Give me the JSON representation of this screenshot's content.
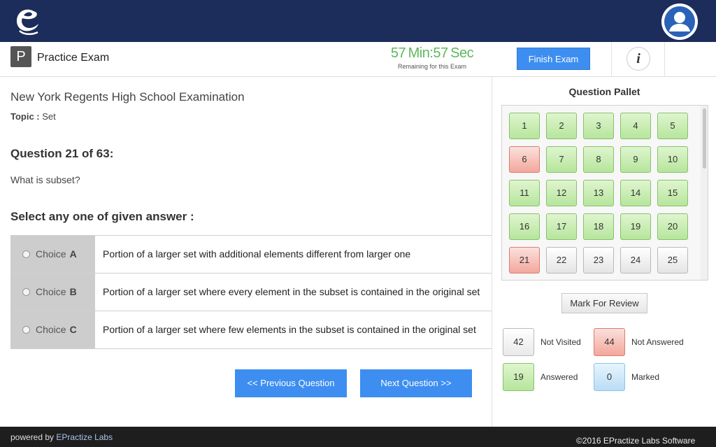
{
  "header": {
    "logo_icon": "epractize-e-logo-icon",
    "avatar_icon": "user-avatar-icon",
    "colors": {
      "topbar": "#1c2c5b",
      "accent": "#3d8ef0",
      "timer": "#5cb85c"
    }
  },
  "subheader": {
    "badge": "P",
    "title": "Practice Exam",
    "timer": {
      "minutes": "57",
      "min_label": "Min",
      "separator": ":",
      "seconds": "57",
      "sec_label": "Sec",
      "subtitle": "Remaining for this Exam"
    },
    "finish_label": "Finish Exam",
    "info_icon": "i"
  },
  "main": {
    "exam_name": "New York Regents High School Examination",
    "topic_label": "Topic :",
    "topic_value": "Set",
    "question_number": "Question 21 of 63:",
    "question_text": "What is subset?",
    "select_label": "Select any one of given answer :",
    "choices": [
      {
        "label": "Choice",
        "letter": "A",
        "text": "Portion of a larger set with additional elements different from larger one"
      },
      {
        "label": "Choice",
        "letter": "B",
        "text": "Portion of a larger set where every element in the subset is contained in the original set"
      },
      {
        "label": "Choice",
        "letter": "C",
        "text": "Portion of a larger set where few elements in the subset is contained in the original set"
      }
    ],
    "prev_label": "<< Previous Question",
    "next_label": "Next Question >>"
  },
  "pallet": {
    "title": "Question Pallet",
    "buttons": [
      {
        "n": "1",
        "status": "answered"
      },
      {
        "n": "2",
        "status": "answered"
      },
      {
        "n": "3",
        "status": "answered"
      },
      {
        "n": "4",
        "status": "answered"
      },
      {
        "n": "5",
        "status": "answered"
      },
      {
        "n": "6",
        "status": "not-answered"
      },
      {
        "n": "7",
        "status": "answered"
      },
      {
        "n": "8",
        "status": "answered"
      },
      {
        "n": "9",
        "status": "answered"
      },
      {
        "n": "10",
        "status": "answered"
      },
      {
        "n": "11",
        "status": "answered"
      },
      {
        "n": "12",
        "status": "answered"
      },
      {
        "n": "13",
        "status": "answered"
      },
      {
        "n": "14",
        "status": "answered"
      },
      {
        "n": "15",
        "status": "answered"
      },
      {
        "n": "16",
        "status": "answered"
      },
      {
        "n": "17",
        "status": "answered"
      },
      {
        "n": "18",
        "status": "answered"
      },
      {
        "n": "19",
        "status": "answered"
      },
      {
        "n": "20",
        "status": "answered"
      },
      {
        "n": "21",
        "status": "not-answered"
      },
      {
        "n": "22",
        "status": "not-visited"
      },
      {
        "n": "23",
        "status": "not-visited"
      },
      {
        "n": "24",
        "status": "not-visited"
      },
      {
        "n": "25",
        "status": "not-visited"
      }
    ],
    "review_label": "Mark For Review",
    "legend": {
      "not_visited": {
        "count": "42",
        "label": "Not Visited"
      },
      "not_answered": {
        "count": "44",
        "label": "Not Answered"
      },
      "answered": {
        "count": "19",
        "label": "Answered"
      },
      "marked": {
        "count": "0",
        "label": "Marked"
      }
    }
  },
  "footer": {
    "powered_prefix": "powered by",
    "powered_brand": "EPractize Labs",
    "copyright": "©2016 EPractize Labs Software"
  }
}
